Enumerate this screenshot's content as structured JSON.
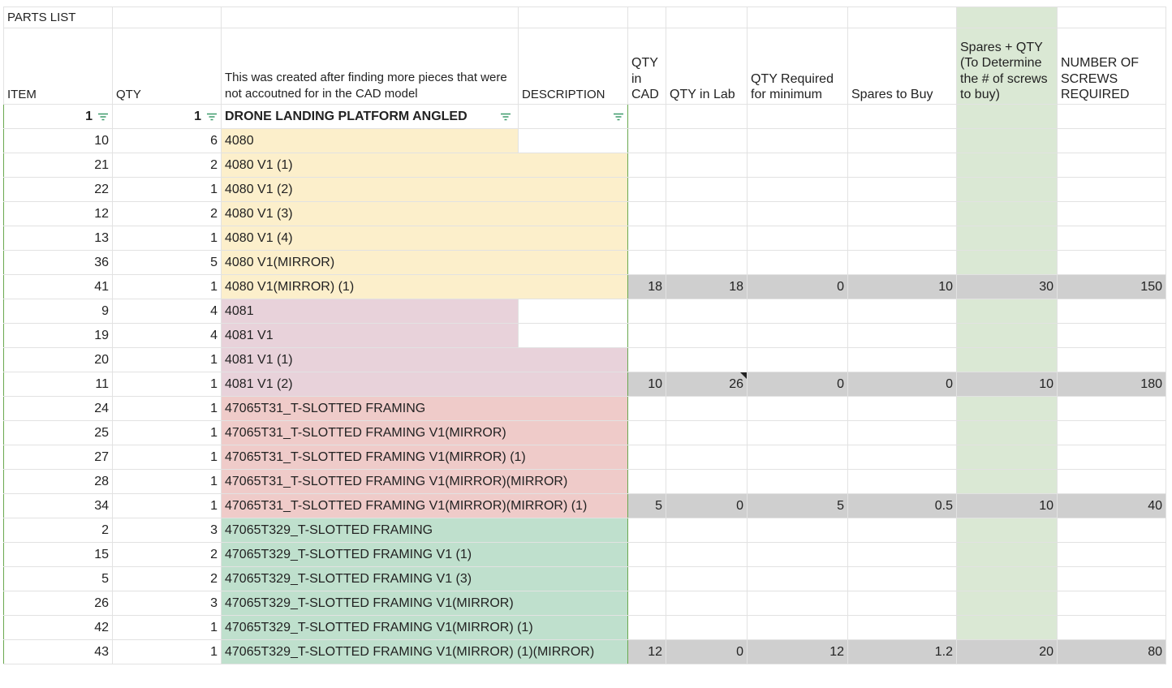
{
  "sheet_title": "PARTS LIST",
  "headers": {
    "item": "ITEM",
    "qty": "QTY",
    "note": "This was created after finding more pieces that were not accoutned for in the CAD model",
    "description": "DESCRIPTION",
    "qty_in_cad": "QTY in CAD",
    "qty_in_lab": "QTY in Lab",
    "qty_required": "QTY Required for minimum",
    "spares_to_buy": "Spares to Buy",
    "spares_plus_qty": "Spares + QTY (To Determine the # of screws to buy)",
    "screws_required": "NUMBER OF SCREWS REQUIRED"
  },
  "filter_row": {
    "item": "1",
    "qty": "1",
    "name": "DRONE LANDING PLATFORM ANGLED"
  },
  "rows": [
    {
      "item": "10",
      "qty": "6",
      "name": "4080"
    },
    {
      "item": "21",
      "qty": "2",
      "name": "4080 V1 (1)"
    },
    {
      "item": "22",
      "qty": "1",
      "name": "4080 V1 (2)"
    },
    {
      "item": "12",
      "qty": "2",
      "name": "4080 V1 (3)"
    },
    {
      "item": "13",
      "qty": "1",
      "name": "4080 V1 (4)"
    },
    {
      "item": "36",
      "qty": "5",
      "name": "4080 V1(MIRROR)"
    },
    {
      "item": "41",
      "qty": "1",
      "name": "4080 V1(MIRROR) (1)"
    },
    {
      "item": "9",
      "qty": "4",
      "name": "4081"
    },
    {
      "item": "19",
      "qty": "4",
      "name": "4081 V1"
    },
    {
      "item": "20",
      "qty": "1",
      "name": "4081 V1 (1)"
    },
    {
      "item": "11",
      "qty": "1",
      "name": "4081 V1 (2)"
    },
    {
      "item": "24",
      "qty": "1",
      "name": "47065T31_T-SLOTTED FRAMING"
    },
    {
      "item": "25",
      "qty": "1",
      "name": "47065T31_T-SLOTTED FRAMING V1(MIRROR)"
    },
    {
      "item": "27",
      "qty": "1",
      "name": "47065T31_T-SLOTTED FRAMING V1(MIRROR) (1)"
    },
    {
      "item": "28",
      "qty": "1",
      "name": "47065T31_T-SLOTTED FRAMING V1(MIRROR)(MIRROR)"
    },
    {
      "item": "34",
      "qty": "1",
      "name": "47065T31_T-SLOTTED FRAMING V1(MIRROR)(MIRROR) (1)"
    },
    {
      "item": "2",
      "qty": "3",
      "name": "47065T329_T-SLOTTED FRAMING"
    },
    {
      "item": "15",
      "qty": "2",
      "name": "47065T329_T-SLOTTED FRAMING V1 (1)"
    },
    {
      "item": "5",
      "qty": "2",
      "name": "47065T329_T-SLOTTED FRAMING V1 (3)"
    },
    {
      "item": "26",
      "qty": "3",
      "name": "47065T329_T-SLOTTED FRAMING V1(MIRROR)"
    },
    {
      "item": "42",
      "qty": "1",
      "name": "47065T329_T-SLOTTED FRAMING V1(MIRROR) (1)"
    },
    {
      "item": "43",
      "qty": "1",
      "name": "47065T329_T-SLOTTED FRAMING V1(MIRROR) (1)(MIRROR)"
    }
  ],
  "summaries": {
    "s1": {
      "cad": "18",
      "lab": "18",
      "req": "0",
      "spares": "10",
      "total": "30",
      "screws": "150"
    },
    "s2": {
      "cad": "10",
      "lab": "26",
      "req": "0",
      "spares": "0",
      "total": "10",
      "screws": "180"
    },
    "s3": {
      "cad": "5",
      "lab": "0",
      "req": "5",
      "spares": "0.5",
      "total": "10",
      "screws": "40"
    },
    "s4": {
      "cad": "12",
      "lab": "0",
      "req": "12",
      "spares": "1.2",
      "total": "20",
      "screws": "80"
    }
  },
  "colors": {
    "yellow_group": "#fcefcb",
    "pink_group": "#e8d2da",
    "red_group": "#efcbc9",
    "green_group": "#bfe0cd",
    "spares_column": "#dae8d4",
    "summary_gray": "#cfcfcf",
    "filter_icon": "#3d9b6a"
  },
  "icons": {
    "filter": "filter-list-icon",
    "comment": "comment-indicator-icon"
  }
}
